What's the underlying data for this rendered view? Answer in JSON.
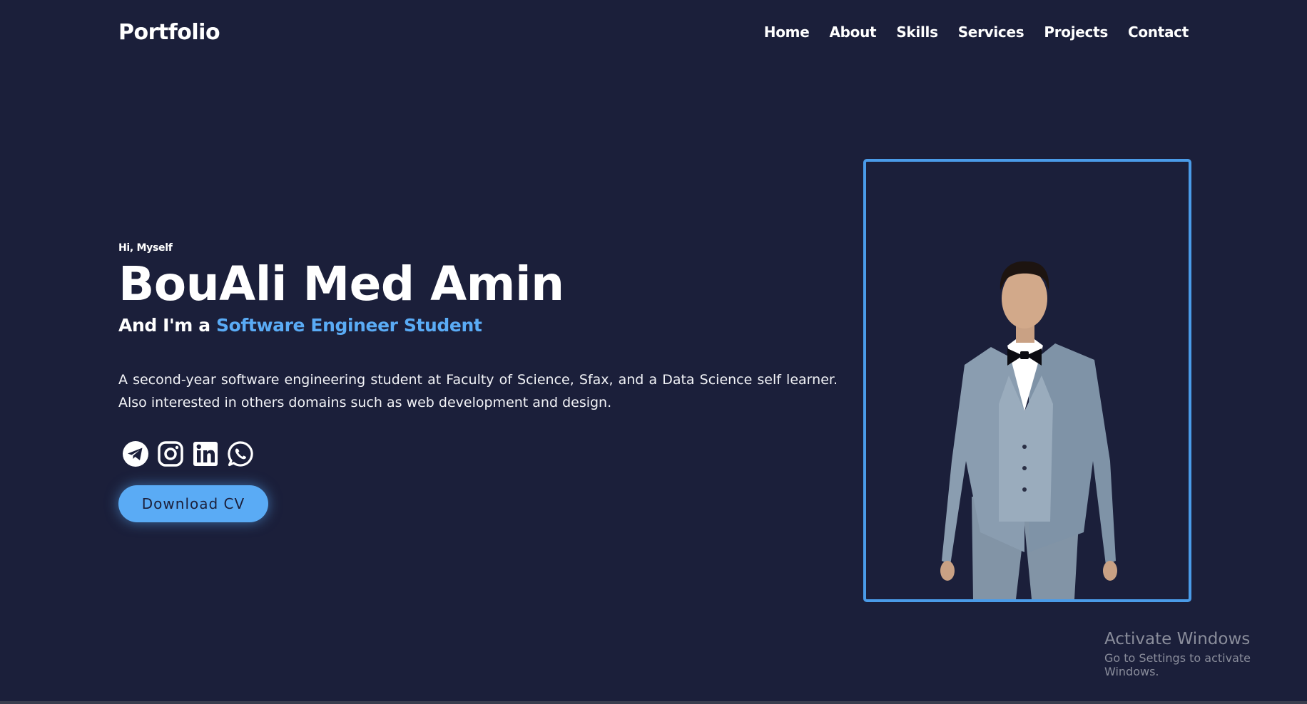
{
  "header": {
    "logo": "Portfolio",
    "nav": [
      {
        "label": "Home"
      },
      {
        "label": "About"
      },
      {
        "label": "Skills"
      },
      {
        "label": "Services"
      },
      {
        "label": "Projects"
      },
      {
        "label": "Contact"
      }
    ]
  },
  "hero": {
    "greeting": "Hi, Myself",
    "name": "BouAli Med Amin",
    "subtitle_prefix": "And I'm a ",
    "subtitle_highlight": "Software Engineer Student",
    "description": "A second-year software engineering student at Faculty of Science, Sfax, and a Data Science self learner. Also interested in others domains such as web development and design.",
    "socials": [
      {
        "icon": "telegram-icon"
      },
      {
        "icon": "instagram-icon"
      },
      {
        "icon": "linkedin-icon"
      },
      {
        "icon": "whatsapp-icon"
      }
    ],
    "download_label": "Download CV"
  },
  "watermark": {
    "title": "Activate Windows",
    "subtitle": "Go to Settings to activate Windows."
  },
  "colors": {
    "background": "#1b1f3a",
    "accent": "#5aabf5",
    "frame_border": "#4a9be8",
    "text": "#ffffff"
  }
}
